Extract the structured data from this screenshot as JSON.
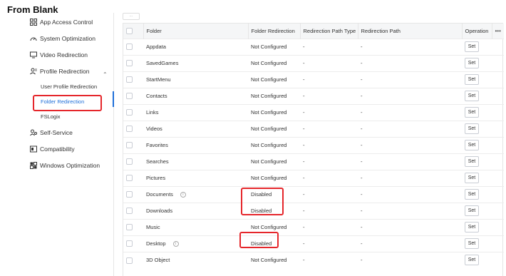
{
  "title": "From Blank",
  "sidebar": {
    "items": [
      {
        "label": "App Access Control",
        "icon": "grid-icon"
      },
      {
        "label": "System Optimization",
        "icon": "gauge-icon"
      },
      {
        "label": "Video Redirection",
        "icon": "monitor-icon"
      },
      {
        "label": "Profile Redirection",
        "icon": "user-group-icon"
      },
      {
        "label": "Self-Service",
        "icon": "self-service-icon"
      },
      {
        "label": "Compatibility",
        "icon": "compat-icon"
      },
      {
        "label": "Windows Optimization",
        "icon": "windows-icon"
      }
    ],
    "sub_items": [
      "User Profile Redirection",
      "Folder Redirection",
      "FSLogix"
    ],
    "expand_icon": "chevron-up-icon"
  },
  "table": {
    "scroll_hint": "···",
    "headers": [
      "Folder",
      "Folder Redirection",
      "Redirection Path Type",
      "Redirection Path",
      "Operation"
    ],
    "more_label": "•••",
    "set_label": "Set",
    "rows": [
      {
        "folder": "Appdata",
        "redirection": "Not Configured",
        "path_type": "-",
        "path": "-",
        "info": false
      },
      {
        "folder": "SavedGames",
        "redirection": "Not Configured",
        "path_type": "-",
        "path": "-",
        "info": false
      },
      {
        "folder": "StartMenu",
        "redirection": "Not Configured",
        "path_type": "-",
        "path": "-",
        "info": false
      },
      {
        "folder": "Contacts",
        "redirection": "Not Configured",
        "path_type": "-",
        "path": "-",
        "info": false
      },
      {
        "folder": "Links",
        "redirection": "Not Configured",
        "path_type": "-",
        "path": "-",
        "info": false
      },
      {
        "folder": "Videos",
        "redirection": "Not Configured",
        "path_type": "-",
        "path": "-",
        "info": false
      },
      {
        "folder": "Favorites",
        "redirection": "Not Configured",
        "path_type": "-",
        "path": "-",
        "info": false
      },
      {
        "folder": "Searches",
        "redirection": "Not Configured",
        "path_type": "-",
        "path": "-",
        "info": false
      },
      {
        "folder": "Pictures",
        "redirection": "Not Configured",
        "path_type": "-",
        "path": "-",
        "info": false
      },
      {
        "folder": "Documents",
        "redirection": "Disabled",
        "path_type": "-",
        "path": "-",
        "info": true
      },
      {
        "folder": "Downloads",
        "redirection": "Disabled",
        "path_type": "-",
        "path": "-",
        "info": false
      },
      {
        "folder": "Music",
        "redirection": "Not Configured",
        "path_type": "-",
        "path": "-",
        "info": false
      },
      {
        "folder": "Desktop",
        "redirection": "Disabled",
        "path_type": "-",
        "path": "-",
        "info": true
      },
      {
        "folder": "3D Object",
        "redirection": "Not Configured",
        "path_type": "-",
        "path": "-",
        "info": false
      }
    ]
  },
  "colors": {
    "accent": "#1e6fd9",
    "highlight": "#e5262b",
    "header_bg": "#f5f6f7"
  }
}
